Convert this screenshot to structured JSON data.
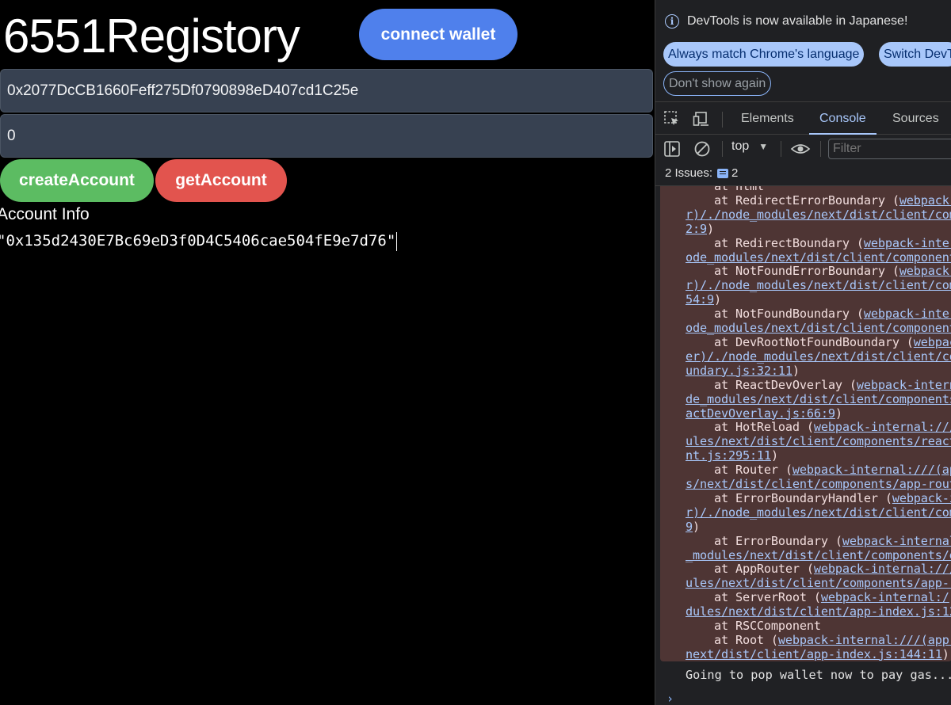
{
  "app": {
    "title": "6551Registory",
    "connect_label": "connect wallet",
    "address_value": "0x2077DcCB1660Feff275Df0790898eD407cd1C25e",
    "token_value": "0",
    "create_label": "createAccount",
    "get_label": "getAccount",
    "info_label": "Account Info",
    "info_value": "\"0x135d2430E7Bc69eD3f0D4C5406cae504fE9e7d76\""
  },
  "devtools": {
    "notice": {
      "icon": "info-icon",
      "text": "DevTools is now available in Japanese!",
      "match_label": "Always match Chrome's language",
      "switch_label": "Switch DevT",
      "dont_show_label": "Don't show again"
    },
    "tabs": [
      {
        "label": "Elements",
        "active": false
      },
      {
        "label": "Console",
        "active": true
      },
      {
        "label": "Sources",
        "active": false
      }
    ],
    "toolbar": {
      "context": "top",
      "filter_placeholder": "Filter"
    },
    "issues": {
      "label": "2 Issues:",
      "count": "2"
    },
    "error_lines": [
      [
        {
          "t": "    at html",
          "l": false
        }
      ],
      [
        {
          "t": "    at RedirectErrorBoundary (",
          "l": false
        },
        {
          "t": "webpack-int",
          "l": true
        }
      ],
      [
        {
          "t": "r)/./node_modules/next/dist/client/com",
          "l": true
        }
      ],
      [
        {
          "t": "2:9",
          "l": true
        },
        {
          "t": ")",
          "l": false
        }
      ],
      [
        {
          "t": "    at RedirectBoundary (",
          "l": false
        },
        {
          "t": "webpack-intern",
          "l": true
        }
      ],
      [
        {
          "t": "ode_modules/next/dist/client/component",
          "l": true
        }
      ],
      [
        {
          "t": "    at NotFoundErrorBoundary (",
          "l": false
        },
        {
          "t": "webpack-",
          "l": true
        }
      ],
      [
        {
          "t": "r)/./node_modules/next/dist/client/com",
          "l": true
        }
      ],
      [
        {
          "t": "54:9",
          "l": true
        },
        {
          "t": ")",
          "l": false
        }
      ],
      [
        {
          "t": "    at NotFoundBoundary (",
          "l": false
        },
        {
          "t": "webpack-inter",
          "l": true
        }
      ],
      [
        {
          "t": "ode_modules/next/dist/client/component",
          "l": true
        }
      ],
      [
        {
          "t": "    at DevRootNotFoundBoundary (",
          "l": false
        },
        {
          "t": "webpac",
          "l": true
        }
      ],
      [
        {
          "t": "er)/./node_modules/next/dist/client/co",
          "l": true
        }
      ],
      [
        {
          "t": "undary.js:32:11",
          "l": true
        },
        {
          "t": ")",
          "l": false
        }
      ],
      [
        {
          "t": "    at ReactDevOverlay (",
          "l": false
        },
        {
          "t": "webpack-intern",
          "l": true
        }
      ],
      [
        {
          "t": "de_modules/next/dist/client/components",
          "l": true
        }
      ],
      [
        {
          "t": "actDevOverlay.js:66:9",
          "l": true
        },
        {
          "t": ")",
          "l": false
        }
      ],
      [
        {
          "t": "    at HotReload (",
          "l": false
        },
        {
          "t": "webpack-internal:///",
          "l": true
        }
      ],
      [
        {
          "t": "ules/next/dist/client/components/react",
          "l": true
        }
      ],
      [
        {
          "t": "nt.js:295:11",
          "l": true
        },
        {
          "t": ")",
          "l": false
        }
      ],
      [
        {
          "t": "    at Router (",
          "l": false
        },
        {
          "t": "webpack-internal:///(ap",
          "l": true
        }
      ],
      [
        {
          "t": "s/next/dist/client/components/app-rout",
          "l": true
        }
      ],
      [
        {
          "t": "    at ErrorBoundaryHandler (",
          "l": false
        },
        {
          "t": "webpack-i",
          "l": true
        }
      ],
      [
        {
          "t": "r)/./node_modules/next/dist/client/com",
          "l": true
        }
      ],
      [
        {
          "t": "9",
          "l": true
        },
        {
          "t": ")",
          "l": false
        }
      ],
      [
        {
          "t": "    at ErrorBoundary (",
          "l": false
        },
        {
          "t": "webpack-internal",
          "l": true
        }
      ],
      [
        {
          "t": "_modules/next/dist/client/components/e",
          "l": true
        }
      ],
      [
        {
          "t": "    at AppRouter (",
          "l": false
        },
        {
          "t": "webpack-internal:///",
          "l": true
        }
      ],
      [
        {
          "t": "ules/next/dist/client/components/app-r",
          "l": true
        }
      ],
      [
        {
          "t": "    at ServerRoot (",
          "l": false
        },
        {
          "t": "webpack-internal:/",
          "l": true
        }
      ],
      [
        {
          "t": "dules/next/dist/client/app-index.js:12",
          "l": true
        }
      ],
      [
        {
          "t": "    at RSCComponent",
          "l": false
        }
      ],
      [
        {
          "t": "    at Root (",
          "l": false
        },
        {
          "t": "webpack-internal:///(app-",
          "l": true
        }
      ],
      [
        {
          "t": "next/dist/client/app-index.js:144:11",
          "l": true
        },
        {
          "t": ")",
          "l": false
        }
      ]
    ],
    "log_message": "Going to pop wallet now to pay gas...",
    "prompt": "›"
  }
}
